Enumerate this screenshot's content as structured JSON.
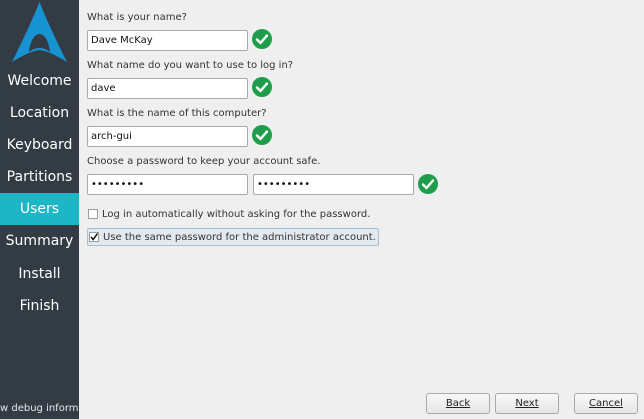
{
  "sidebar": {
    "logo_icon": "arch-linux-logo",
    "items": [
      {
        "label": "Welcome"
      },
      {
        "label": "Location"
      },
      {
        "label": "Keyboard"
      },
      {
        "label": "Partitions"
      },
      {
        "label": "Users",
        "active": true
      },
      {
        "label": "Summary"
      },
      {
        "label": "Install"
      },
      {
        "label": "Finish"
      }
    ],
    "debug_label": "w debug informa"
  },
  "form": {
    "name_label": "What is your name?",
    "name_value": "Dave McKay",
    "login_label": "What name do you want to use to log in?",
    "login_value": "dave",
    "computer_label": "What is the name of this computer?",
    "computer_value": "arch-gui",
    "password_label": "Choose a password to keep your account safe.",
    "password_value": "•••••••••",
    "password_confirm_value": "•••••••••",
    "autologin_label": "Log in automatically without asking for the password.",
    "autologin_checked": false,
    "same_password_label": "Use the same password for the administrator account.",
    "same_password_checked": true
  },
  "buttons": {
    "back_label": "Back",
    "next_label": "Next",
    "cancel_label": "Cancel"
  },
  "colors": {
    "sidebar_bg": "#333c44",
    "active_item": "#1cb6c6",
    "check_ok": "#1e9e4a",
    "content_bg": "#efefef"
  }
}
